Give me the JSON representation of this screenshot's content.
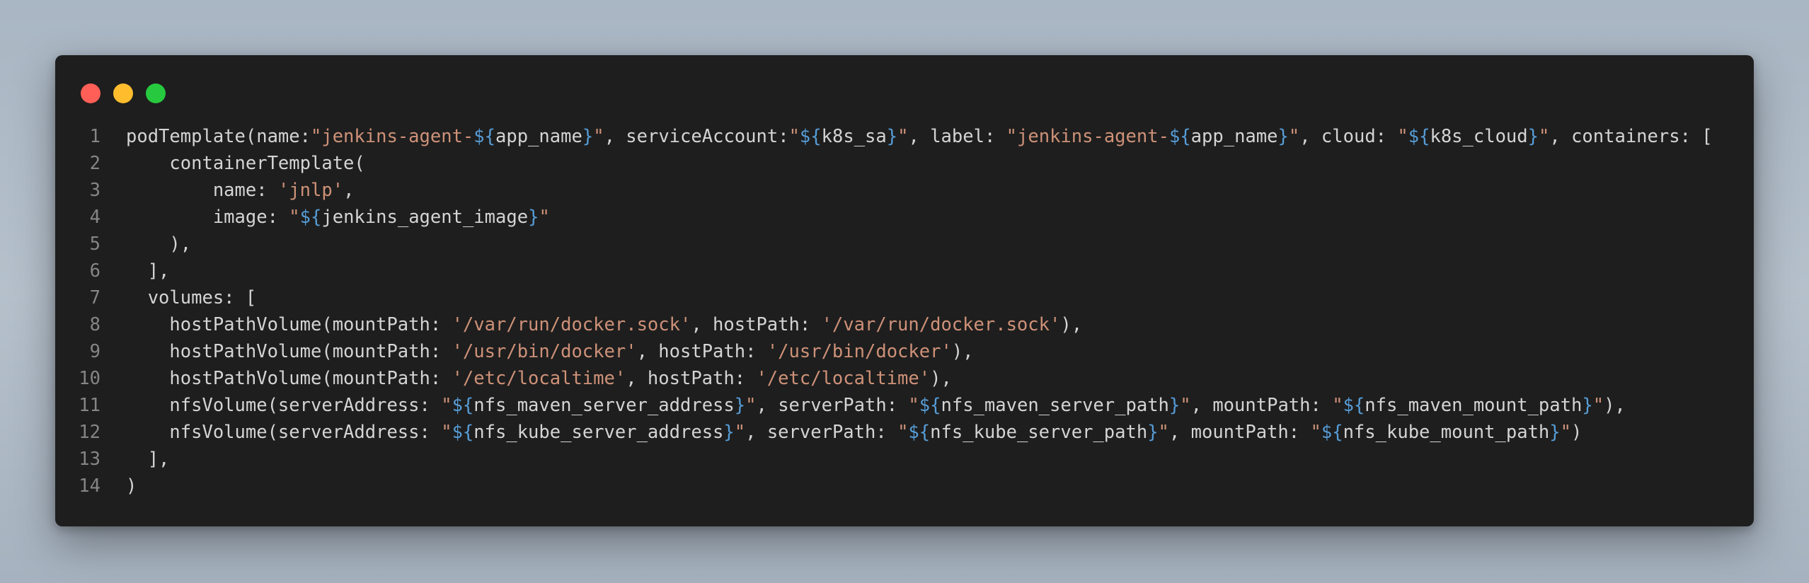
{
  "colors": {
    "background": "#aeb9c5",
    "editor_bg": "#1e1e1e",
    "close": "#ff5f56",
    "minimize": "#ffbd2e",
    "maximize": "#27c93f",
    "line_number": "#858585",
    "plain": "#d4d4d4",
    "string": "#ce9178",
    "interpolation": "#569cd6"
  },
  "window": {
    "buttons": [
      {
        "name": "close-button",
        "color": "#ff5f56"
      },
      {
        "name": "minimize-button",
        "color": "#ffbd2e"
      },
      {
        "name": "maximize-button",
        "color": "#27c93f"
      }
    ]
  },
  "code": {
    "lines": [
      {
        "number": "1",
        "tokens": [
          [
            "plain",
            "podTemplate(name:"
          ],
          [
            "string",
            "\"jenkins-agent-"
          ],
          [
            "interp",
            "${"
          ],
          [
            "plain",
            "app_name"
          ],
          [
            "interp",
            "}"
          ],
          [
            "string",
            "\""
          ],
          [
            "plain",
            ", serviceAccount:"
          ],
          [
            "string",
            "\""
          ],
          [
            "interp",
            "${"
          ],
          [
            "plain",
            "k8s_sa"
          ],
          [
            "interp",
            "}"
          ],
          [
            "string",
            "\""
          ],
          [
            "plain",
            ", label: "
          ],
          [
            "string",
            "\"jenkins-agent-"
          ],
          [
            "interp",
            "${"
          ],
          [
            "plain",
            "app_name"
          ],
          [
            "interp",
            "}"
          ],
          [
            "string",
            "\""
          ],
          [
            "plain",
            ", cloud: "
          ],
          [
            "string",
            "\""
          ],
          [
            "interp",
            "${"
          ],
          [
            "plain",
            "k8s_cloud"
          ],
          [
            "interp",
            "}"
          ],
          [
            "string",
            "\""
          ],
          [
            "plain",
            ", containers: ["
          ]
        ]
      },
      {
        "number": "2",
        "tokens": [
          [
            "plain",
            "    containerTemplate("
          ]
        ]
      },
      {
        "number": "3",
        "tokens": [
          [
            "plain",
            "        name: "
          ],
          [
            "string",
            "'jnlp'"
          ],
          [
            "plain",
            ","
          ]
        ]
      },
      {
        "number": "4",
        "tokens": [
          [
            "plain",
            "        image: "
          ],
          [
            "string",
            "\""
          ],
          [
            "interp",
            "${"
          ],
          [
            "plain",
            "jenkins_agent_image"
          ],
          [
            "interp",
            "}"
          ],
          [
            "string",
            "\""
          ]
        ]
      },
      {
        "number": "5",
        "tokens": [
          [
            "plain",
            "    ),"
          ]
        ]
      },
      {
        "number": "6",
        "tokens": [
          [
            "plain",
            "  ],"
          ]
        ]
      },
      {
        "number": "7",
        "tokens": [
          [
            "plain",
            "  volumes: ["
          ]
        ]
      },
      {
        "number": "8",
        "tokens": [
          [
            "plain",
            "    hostPathVolume(mountPath: "
          ],
          [
            "string",
            "'/var/run/docker.sock'"
          ],
          [
            "plain",
            ", hostPath: "
          ],
          [
            "string",
            "'/var/run/docker.sock'"
          ],
          [
            "plain",
            "),"
          ]
        ]
      },
      {
        "number": "9",
        "tokens": [
          [
            "plain",
            "    hostPathVolume(mountPath: "
          ],
          [
            "string",
            "'/usr/bin/docker'"
          ],
          [
            "plain",
            ", hostPath: "
          ],
          [
            "string",
            "'/usr/bin/docker'"
          ],
          [
            "plain",
            "),"
          ]
        ]
      },
      {
        "number": "10",
        "tokens": [
          [
            "plain",
            "    hostPathVolume(mountPath: "
          ],
          [
            "string",
            "'/etc/localtime'"
          ],
          [
            "plain",
            ", hostPath: "
          ],
          [
            "string",
            "'/etc/localtime'"
          ],
          [
            "plain",
            "),"
          ]
        ]
      },
      {
        "number": "11",
        "tokens": [
          [
            "plain",
            "    nfsVolume(serverAddress: "
          ],
          [
            "string",
            "\""
          ],
          [
            "interp",
            "${"
          ],
          [
            "plain",
            "nfs_maven_server_address"
          ],
          [
            "interp",
            "}"
          ],
          [
            "string",
            "\""
          ],
          [
            "plain",
            ", serverPath: "
          ],
          [
            "string",
            "\""
          ],
          [
            "interp",
            "${"
          ],
          [
            "plain",
            "nfs_maven_server_path"
          ],
          [
            "interp",
            "}"
          ],
          [
            "string",
            "\""
          ],
          [
            "plain",
            ", mountPath: "
          ],
          [
            "string",
            "\""
          ],
          [
            "interp",
            "${"
          ],
          [
            "plain",
            "nfs_maven_mount_path"
          ],
          [
            "interp",
            "}"
          ],
          [
            "string",
            "\""
          ],
          [
            "plain",
            "),"
          ]
        ]
      },
      {
        "number": "12",
        "tokens": [
          [
            "plain",
            "    nfsVolume(serverAddress: "
          ],
          [
            "string",
            "\""
          ],
          [
            "interp",
            "${"
          ],
          [
            "plain",
            "nfs_kube_server_address"
          ],
          [
            "interp",
            "}"
          ],
          [
            "string",
            "\""
          ],
          [
            "plain",
            ", serverPath: "
          ],
          [
            "string",
            "\""
          ],
          [
            "interp",
            "${"
          ],
          [
            "plain",
            "nfs_kube_server_path"
          ],
          [
            "interp",
            "}"
          ],
          [
            "string",
            "\""
          ],
          [
            "plain",
            ", mountPath: "
          ],
          [
            "string",
            "\""
          ],
          [
            "interp",
            "${"
          ],
          [
            "plain",
            "nfs_kube_mount_path"
          ],
          [
            "interp",
            "}"
          ],
          [
            "string",
            "\""
          ],
          [
            "plain",
            ")"
          ]
        ]
      },
      {
        "number": "13",
        "tokens": [
          [
            "plain",
            "  ],"
          ]
        ]
      },
      {
        "number": "14",
        "tokens": [
          [
            "plain",
            ")"
          ]
        ]
      }
    ]
  }
}
